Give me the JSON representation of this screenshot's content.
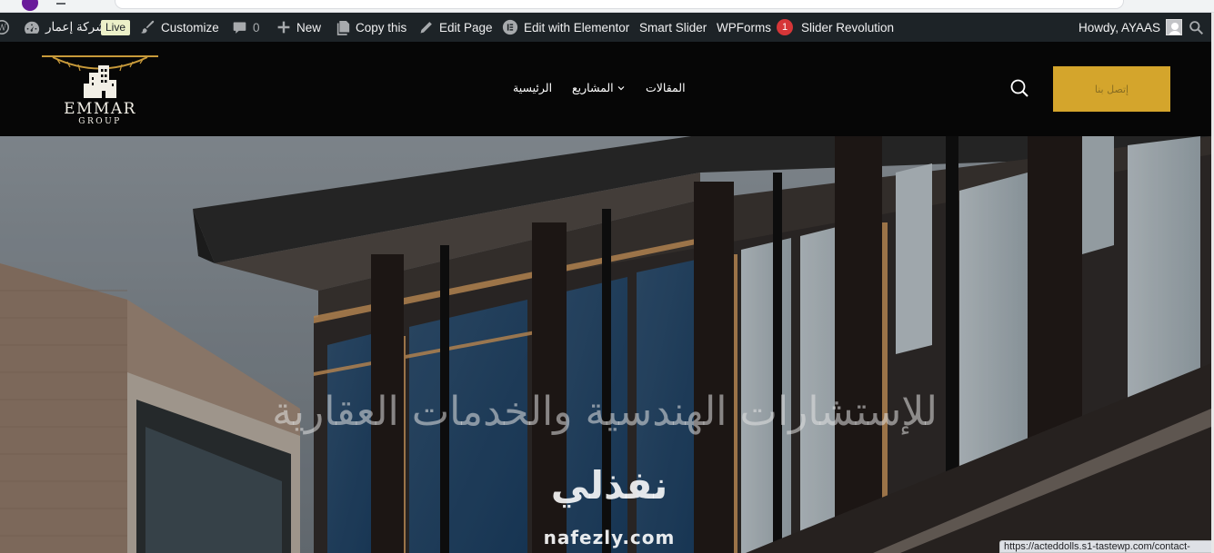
{
  "browser": {
    "status_url": "https://acteddolls.s1-tastewp.com/contact-"
  },
  "admin_bar": {
    "site_name": "شركة إعمار",
    "live_label": "Live",
    "customize": "Customize",
    "comments_count": "0",
    "new": "New",
    "copy_this": "Copy this",
    "edit_page": "Edit Page",
    "edit_elementor": "Edit with Elementor",
    "smart_slider": "Smart Slider",
    "wpforms": "WPForms",
    "wpforms_count": "1",
    "slider_revolution": "Slider Revolution",
    "howdy": "Howdy, AYAAS",
    "icons": [
      "wordpress-icon",
      "dashboard-icon",
      "brush-icon",
      "comment-icon",
      "plus-icon",
      "copy-icon",
      "pencil-icon",
      "elementor-icon",
      "avatar",
      "search-icon"
    ]
  },
  "header": {
    "logo_word": "EMMAR",
    "logo_sub": "GROUP",
    "nav": {
      "home": "الرئيسية",
      "projects": "المشاريع",
      "articles": "المقالات"
    },
    "cta_label": "إتصل بنا",
    "accent": "#d4a52c"
  },
  "hero": {
    "title": "للإستشارات الهندسية والخدمات العقارية"
  },
  "watermark": {
    "arabic": "نفذلي",
    "latin": "nafezly.com"
  }
}
